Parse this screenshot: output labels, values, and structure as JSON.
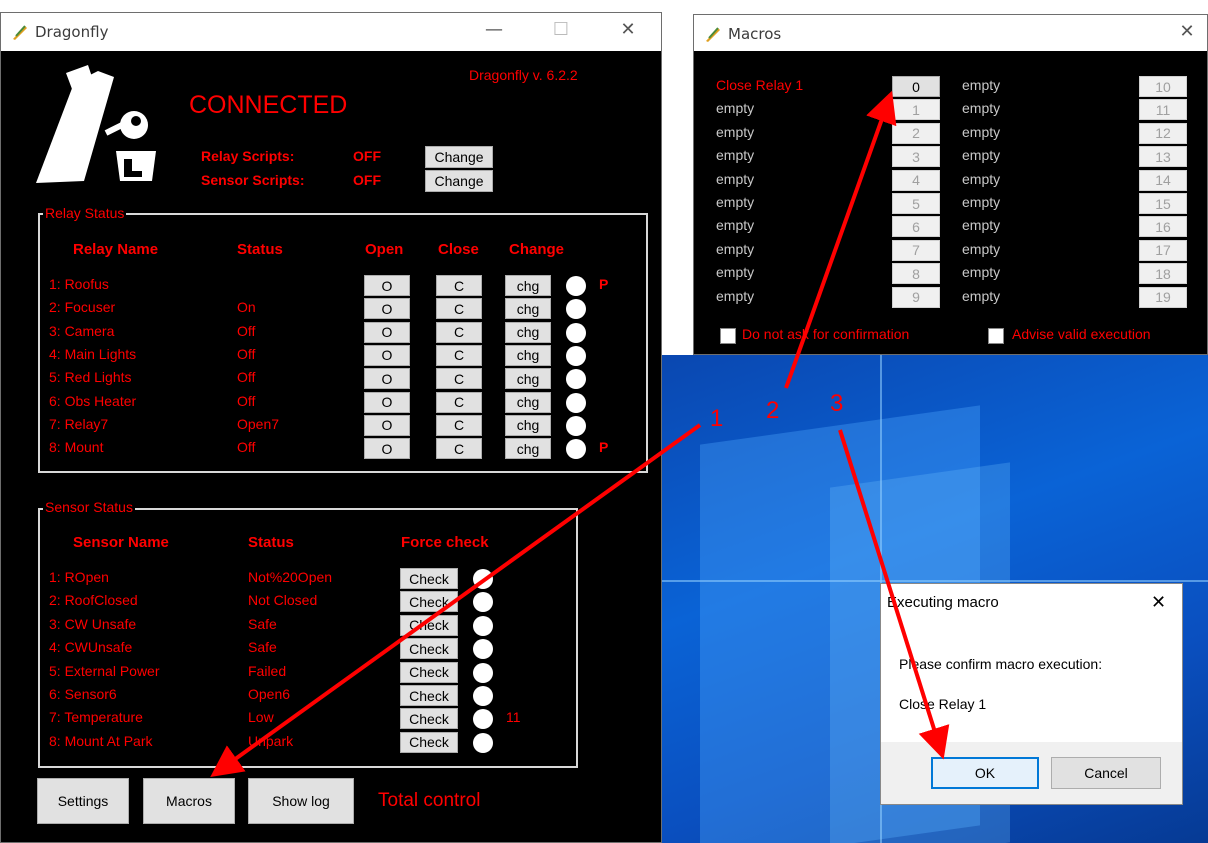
{
  "colors": {
    "accent": "#ff0000",
    "window_bg": "#000000",
    "button_bg": "#e1e1e1",
    "desktop": "#0a63d6"
  },
  "dragonfly": {
    "title": "Dragonfly",
    "minimize": "—",
    "maximize": "☐",
    "close": "✕",
    "version": "Dragonfly v. 6.2.2",
    "status": "CONNECTED",
    "relay_scripts_label": "Relay Scripts:",
    "relay_scripts_value": "OFF",
    "sensor_scripts_label": "Sensor Scripts:",
    "sensor_scripts_value": "OFF",
    "change_label": "Change",
    "relay_group": "Relay Status",
    "relay_headers": {
      "name": "Relay Name",
      "status": "Status",
      "open": "Open",
      "close": "Close",
      "change": "Change"
    },
    "relays": [
      {
        "name": "1: Roofus",
        "status": "",
        "open": "O",
        "close": "C",
        "chg": "chg",
        "flag": "P"
      },
      {
        "name": "2: Focuser",
        "status": "On",
        "open": "O",
        "close": "C",
        "chg": "chg",
        "flag": ""
      },
      {
        "name": "3: Camera",
        "status": "Off",
        "open": "O",
        "close": "C",
        "chg": "chg",
        "flag": ""
      },
      {
        "name": "4: Main Lights",
        "status": "Off",
        "open": "O",
        "close": "C",
        "chg": "chg",
        "flag": ""
      },
      {
        "name": "5: Red Lights",
        "status": "Off",
        "open": "O",
        "close": "C",
        "chg": "chg",
        "flag": ""
      },
      {
        "name": "6: Obs Heater",
        "status": "Off",
        "open": "O",
        "close": "C",
        "chg": "chg",
        "flag": ""
      },
      {
        "name": "7: Relay7",
        "status": "Open7",
        "open": "O",
        "close": "C",
        "chg": "chg",
        "flag": ""
      },
      {
        "name": "8: Mount",
        "status": "Off",
        "open": "O",
        "close": "C",
        "chg": "chg",
        "flag": "P"
      }
    ],
    "sensor_group": "Sensor Status",
    "sensor_headers": {
      "name": "Sensor Name",
      "status": "Status",
      "force": "Force check"
    },
    "sensors": [
      {
        "name": "1: ROpen",
        "status": "Not%20Open",
        "check": "Check",
        "value": ""
      },
      {
        "name": "2: RoofClosed",
        "status": "Not Closed",
        "check": "Check",
        "value": ""
      },
      {
        "name": "3: CW Unsafe",
        "status": "Safe",
        "check": "Check",
        "value": ""
      },
      {
        "name": "4: CWUnsafe",
        "status": "Safe",
        "check": "Check",
        "value": ""
      },
      {
        "name": "5: External Power",
        "status": "Failed",
        "check": "Check",
        "value": ""
      },
      {
        "name": "6: Sensor6",
        "status": "Open6",
        "check": "Check",
        "value": ""
      },
      {
        "name": "7: Temperature",
        "status": "Low",
        "check": "Check",
        "value": "11"
      },
      {
        "name": "8: Mount At Park",
        "status": "Unpark",
        "check": "Check",
        "value": ""
      }
    ],
    "bottom": {
      "settings": "Settings",
      "macros": "Macros",
      "showlog": "Show log",
      "tagline": "Total control"
    }
  },
  "macros": {
    "title": "Macros",
    "close": "✕",
    "left": [
      {
        "label": "Close Relay 1",
        "btn": "0"
      },
      {
        "label": "empty",
        "btn": "1"
      },
      {
        "label": "empty",
        "btn": "2"
      },
      {
        "label": "empty",
        "btn": "3"
      },
      {
        "label": "empty",
        "btn": "4"
      },
      {
        "label": "empty",
        "btn": "5"
      },
      {
        "label": "empty",
        "btn": "6"
      },
      {
        "label": "empty",
        "btn": "7"
      },
      {
        "label": "empty",
        "btn": "8"
      },
      {
        "label": "empty",
        "btn": "9"
      }
    ],
    "right": [
      {
        "label": "empty",
        "btn": "10"
      },
      {
        "label": "empty",
        "btn": "11"
      },
      {
        "label": "empty",
        "btn": "12"
      },
      {
        "label": "empty",
        "btn": "13"
      },
      {
        "label": "empty",
        "btn": "14"
      },
      {
        "label": "empty",
        "btn": "15"
      },
      {
        "label": "empty",
        "btn": "16"
      },
      {
        "label": "empty",
        "btn": "17"
      },
      {
        "label": "empty",
        "btn": "18"
      },
      {
        "label": "empty",
        "btn": "19"
      }
    ],
    "no_confirm": "Do not ask for confirmation",
    "advise": "Advise valid execution"
  },
  "dialog": {
    "title": "Executing macro",
    "close": "✕",
    "message": "Please confirm macro execution:",
    "macro": "Close Relay 1",
    "ok": "OK",
    "cancel": "Cancel"
  },
  "annotations": {
    "n1": "1",
    "n2": "2",
    "n3": "3"
  }
}
